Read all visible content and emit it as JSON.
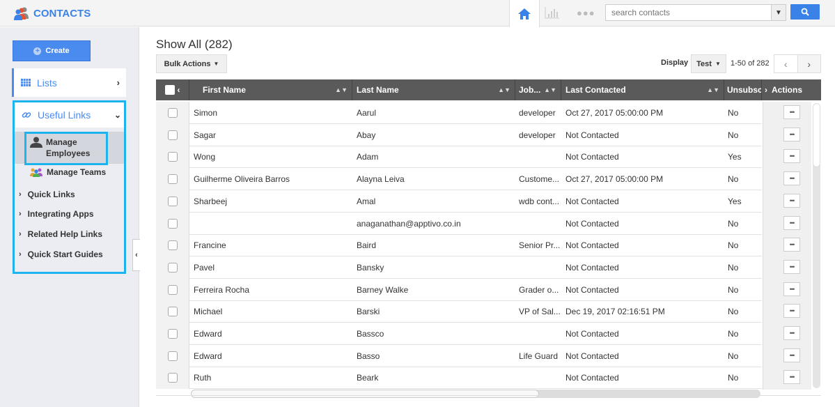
{
  "app": {
    "title": "CONTACTS"
  },
  "topbar": {
    "search_placeholder": "search contacts",
    "home_icon": "home-icon",
    "chart_icon": "bar-chart-icon",
    "more_icon": "more-dots-icon",
    "more_text": "●●●"
  },
  "sidebar": {
    "create_label": "Create",
    "lists_label": "Lists",
    "useful_links_label": "Useful Links",
    "manage_employees_line1": "Manage",
    "manage_employees_line2": "Employees",
    "manage_teams_label": "Manage Teams",
    "sub_links": [
      "Quick Links",
      "Integrating Apps",
      "Related Help Links",
      "Quick Start Guides"
    ]
  },
  "main": {
    "title": "Show All (282)",
    "bulk_actions_label": "Bulk Actions",
    "display_label": "Display",
    "display_value": "Test",
    "range": "1-50 of 282",
    "columns": {
      "first_name": "First Name",
      "last_name": "Last Name",
      "job": "Job...",
      "last_contacted": "Last Contacted",
      "unsubscribed": "Unsubsc",
      "actions": "Actions"
    },
    "action_glyph": "•••",
    "rows": [
      {
        "first": "Simon",
        "last": "Aarul",
        "job": "developer",
        "contacted": "Oct 27, 2017 05:00:00 PM",
        "unsub": "No"
      },
      {
        "first": "Sagar",
        "last": "Abay",
        "job": "developer",
        "contacted": "Not Contacted",
        "unsub": "No"
      },
      {
        "first": "Wong",
        "last": "Adam",
        "job": "",
        "contacted": "Not Contacted",
        "unsub": "Yes"
      },
      {
        "first": "Guilherme Oliveira Barros",
        "last": "Alayna Leiva",
        "job": "Custome...",
        "contacted": "Oct 27, 2017 05:00:00 PM",
        "unsub": "No"
      },
      {
        "first": "Sharbeej",
        "last": "Amal",
        "job": "wdb cont...",
        "contacted": "Not Contacted",
        "unsub": "Yes"
      },
      {
        "first": "",
        "last": "anaganathan@apptivo.co.in",
        "job": "",
        "contacted": "Not Contacted",
        "unsub": "No"
      },
      {
        "first": "Francine",
        "last": "Baird",
        "job": "Senior Pr...",
        "contacted": "Not Contacted",
        "unsub": "No"
      },
      {
        "first": "Pavel",
        "last": "Bansky",
        "job": "",
        "contacted": "Not Contacted",
        "unsub": "No"
      },
      {
        "first": "Ferreira Rocha",
        "last": "Barney Walke",
        "job": "Grader o...",
        "contacted": "Not Contacted",
        "unsub": "No"
      },
      {
        "first": "Michael",
        "last": "Barski",
        "job": "VP of Sal...",
        "contacted": "Dec 19, 2017 02:16:51 PM",
        "unsub": "No"
      },
      {
        "first": "Edward",
        "last": "Bassco",
        "job": "",
        "contacted": "Not Contacted",
        "unsub": "No"
      },
      {
        "first": "Edward",
        "last": "Basso",
        "job": "Life Guard",
        "contacted": "Not Contacted",
        "unsub": "No"
      },
      {
        "first": "Ruth",
        "last": "Beark",
        "job": "",
        "contacted": "Not Contacted",
        "unsub": "No"
      }
    ]
  },
  "colors": {
    "accent": "#3b82e8",
    "highlight": "#1db4ee",
    "header_bg": "#5a5a5a"
  }
}
